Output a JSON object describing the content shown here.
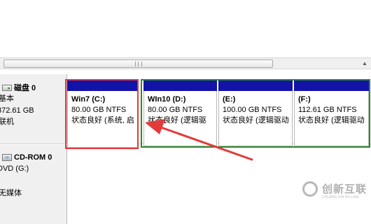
{
  "disk0": {
    "name": "磁盘 0",
    "type_truncated": "基本",
    "size_truncated": "372.61 GB",
    "status_truncated": "联机"
  },
  "cdrom0": {
    "name": "CD-ROM 0",
    "drive_truncated": "DVD (G:)",
    "media_truncated": "无媒体"
  },
  "partitions": [
    {
      "name": "Win7  (C:)",
      "size": "80.00 GB NTFS",
      "status": "状态良好 (系统, 启"
    },
    {
      "name": "WIn10  (D:)",
      "size": "80.00 GB NTFS",
      "status": "状态良好 (逻辑驱"
    },
    {
      "name": "(E:)",
      "size": "100.00 GB NTFS",
      "status": "状态良好 (逻辑驱动"
    },
    {
      "name": "(F:)",
      "size": "112.61 GB NTFS",
      "status": "状态良好 (逻辑驱动"
    }
  ],
  "colors": {
    "partition_bar": "#1313a8",
    "extended_frame": "#2b8a2b",
    "highlight": "#e33a3a"
  },
  "watermark": {
    "brand": "创新互联",
    "sub": "CHUANG XIN HU LIAN"
  }
}
